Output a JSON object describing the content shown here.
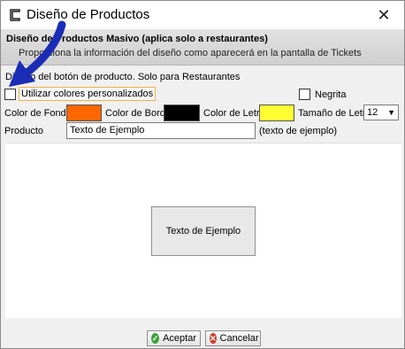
{
  "window": {
    "title": "Diseño de Productos",
    "close_glyph": "✕"
  },
  "header": {
    "title": "Diseño de Productos Masivo (aplica solo a restaurantes)",
    "subtitle": "Proporciona la información del diseño como aparecerá en la pantalla de Tickets"
  },
  "description": "Diseño del botón de producto. Solo para Restaurantes",
  "options": {
    "custom_colors_label": "Utilizar colores personalizados",
    "custom_colors_checked": false,
    "bold_label": "Negrita",
    "bold_checked": false
  },
  "colors": {
    "background_label": "Color de Fondo",
    "background_value": "#FF6600",
    "border_label": "Color de Borde",
    "border_value": "#000000",
    "text_label": "Color de Letra",
    "text_value": "#FFFF33"
  },
  "font_size": {
    "label": "Tamaño de Letra",
    "value": "12",
    "arrow": "▼"
  },
  "product": {
    "label": "Producto",
    "value": "Texto de Ejemplo",
    "hint": "(texto de ejemplo)"
  },
  "preview": {
    "button_text": "Texto de Ejemplo"
  },
  "footer": {
    "accept_label": "Aceptar",
    "accept_icon": "✓",
    "cancel_label": "Cancelar",
    "cancel_icon": "✕"
  },
  "accent_colors": {
    "accept": "#3aa53a",
    "cancel": "#d33a2c",
    "annotation_arrow": "#1c2db5"
  }
}
